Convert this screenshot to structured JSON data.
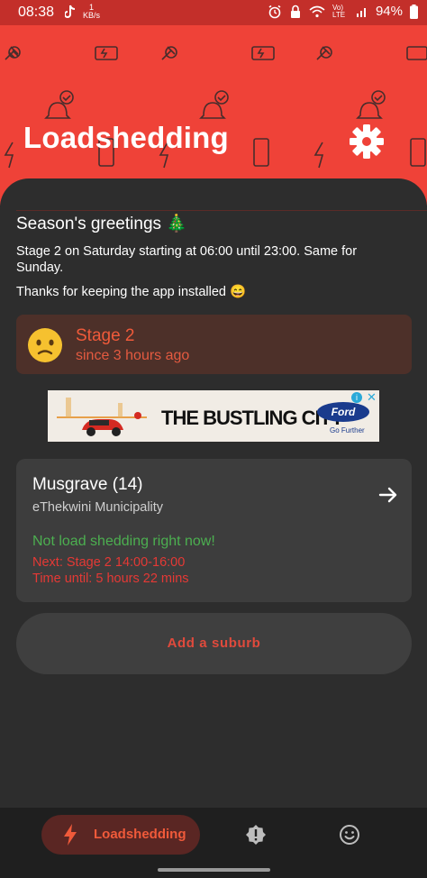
{
  "status_bar": {
    "time": "08:38",
    "speed_value": "1",
    "speed_unit": "KB/s",
    "battery": "94%",
    "network": "Vo) LTE"
  },
  "header": {
    "title": "Loadshedding"
  },
  "greeting": {
    "title": "Season's greetings 🎄",
    "body": "Stage 2 on Saturday starting at 06:00 until 23:00. Same for Sunday.",
    "thanks": "Thanks for keeping the app installed 😄"
  },
  "stage": {
    "name": "Stage 2",
    "since": "since 3 hours ago"
  },
  "ad": {
    "headline": "THE BUSTLING CITY",
    "brand": "Ford",
    "tagline": "Go Further"
  },
  "suburb": {
    "name": "Musgrave (14)",
    "municipality": "eThekwini Municipality",
    "status": "Not load shedding right now!",
    "next": "Next: Stage 2 14:00-16:00",
    "time_until": "Time until: 5 hours 22 mins"
  },
  "actions": {
    "add_suburb": "Add a suburb"
  },
  "nav": {
    "active_label": "Loadshedding"
  },
  "colors": {
    "header": "#ef4238",
    "accent": "#f05a3a",
    "ok": "#4caf50",
    "warning": "#e53935"
  }
}
